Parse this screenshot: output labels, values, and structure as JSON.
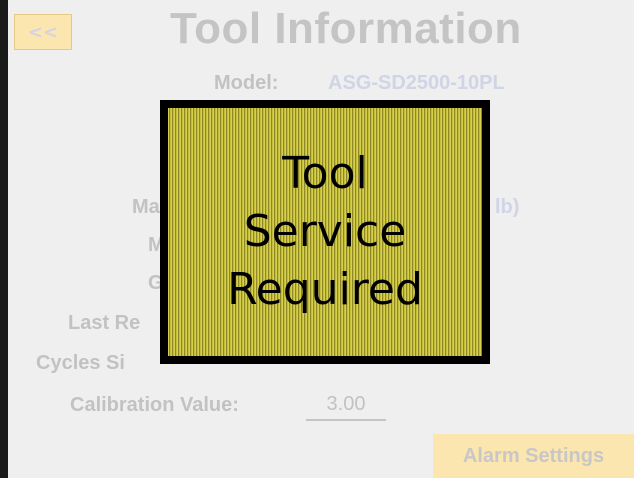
{
  "header": {
    "back_label": "<<",
    "title": "Tool Information"
  },
  "info": {
    "model_label": "Model:",
    "model_value": "ASG-SD2500-10PL",
    "row3_partial_label": "Ma",
    "row3_partial_value": "lb)",
    "row4_partial_label": "M",
    "row5_partial_label": "G",
    "last_repair_partial_label": "Last Re",
    "cycles_partial_label": "Cycles Si",
    "calibration_label": "Calibration Value:",
    "calibration_value": "3.00"
  },
  "footer": {
    "alarm_settings_label": "Alarm Settings"
  },
  "alert": {
    "line1": "Tool",
    "line2": "Service",
    "line3": "Required",
    "color": "#c9c23e"
  }
}
